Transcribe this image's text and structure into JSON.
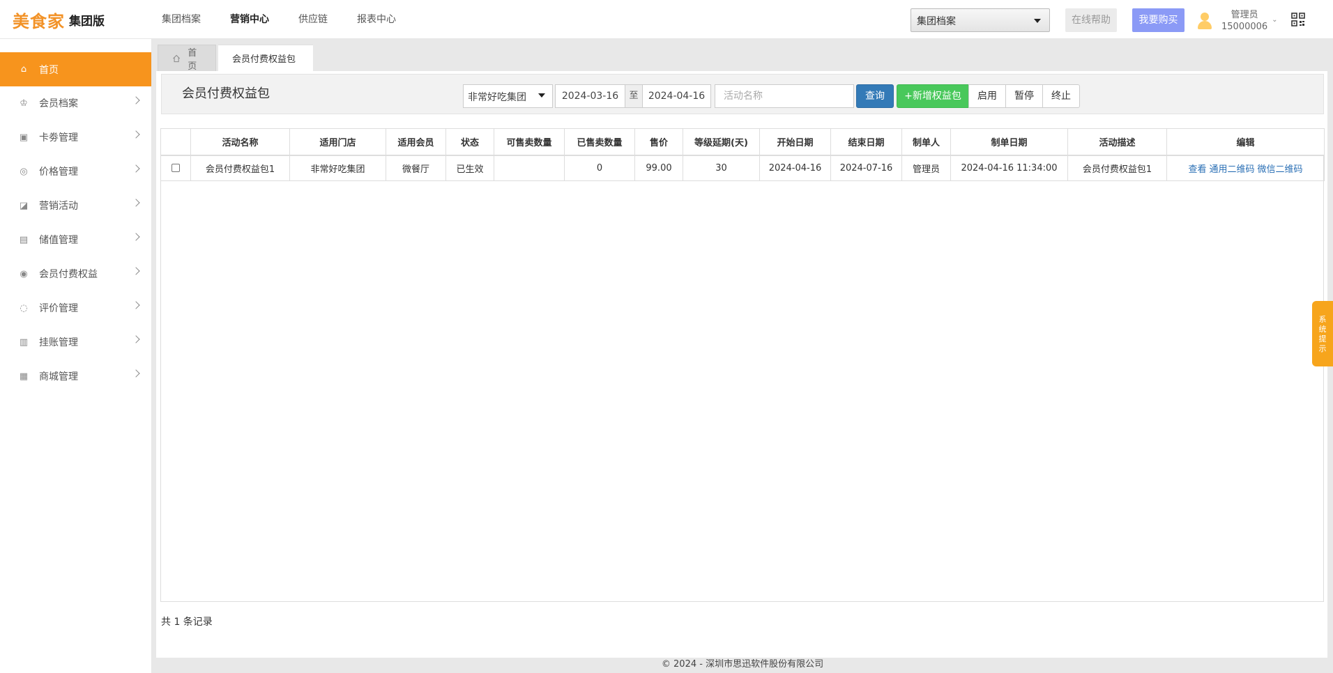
{
  "header": {
    "brand": "美食家",
    "edition": "集团版",
    "nav": [
      "集团档案",
      "营销中心",
      "供应链",
      "报表中心"
    ],
    "active_nav": 1,
    "group_select": "集团档案",
    "help_label": "在线帮助",
    "buy_label": "我要购买",
    "user_role": "管理员",
    "user_id": "15000006"
  },
  "sidebar": {
    "items": [
      {
        "label": "首页",
        "icon": "home-icon"
      },
      {
        "label": "会员档案",
        "icon": "crown-icon"
      },
      {
        "label": "卡劵管理",
        "icon": "card-icon"
      },
      {
        "label": "价格管理",
        "icon": "price-icon"
      },
      {
        "label": "营销活动",
        "icon": "chart-icon"
      },
      {
        "label": "储值管理",
        "icon": "wallet-icon"
      },
      {
        "label": "会员付费权益",
        "icon": "vip-icon"
      },
      {
        "label": "评价管理",
        "icon": "comment-icon"
      },
      {
        "label": "挂账管理",
        "icon": "ledger-icon"
      },
      {
        "label": "商城管理",
        "icon": "shop-icon"
      }
    ]
  },
  "tabs": {
    "home": "首页",
    "current": "会员付费权益包"
  },
  "toolbar": {
    "title": "会员付费权益包",
    "store": "非常好吃集团",
    "date_start": "2024-03-16",
    "date_sep": "至",
    "date_end": "2024-04-16",
    "name_placeholder": "活动名称",
    "query": "查询",
    "add": "+新增权益包",
    "enable": "启用",
    "pause": "暂停",
    "stop": "终止"
  },
  "table": {
    "headers": [
      "活动名称",
      "适用门店",
      "适用会员",
      "状态",
      "可售卖数量",
      "已售卖数量",
      "售价",
      "等级延期(天)",
      "开始日期",
      "结束日期",
      "制单人",
      "制单日期",
      "活动描述",
      "编辑"
    ],
    "rows": [
      {
        "name": "会员付费权益包1",
        "store": "非常好吃集团",
        "member": "微餐厅",
        "status": "已生效",
        "sellable": "",
        "sold": "0",
        "price": "99.00",
        "extend_days": "30",
        "start": "2024-04-16",
        "end": "2024-07-16",
        "creator": "管理员",
        "created_at": "2024-04-16 11:34:00",
        "desc": "会员付费权益包1",
        "actions": [
          "查看",
          "通用二维码",
          "微信二维码"
        ]
      }
    ]
  },
  "total_text": "共 1 条记录",
  "footer": "© 2024 - 深圳市思迅软件股份有限公司",
  "system_tip": "系统提示",
  "colors": {
    "accent": "#f7941d",
    "query": "#337ab7",
    "add": "#49c85b",
    "buy": "#8b9af6",
    "link": "#2a6fb5"
  }
}
